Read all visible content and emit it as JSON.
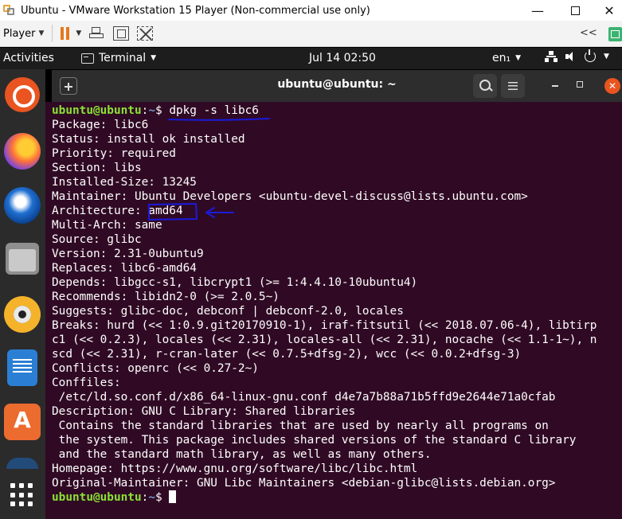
{
  "vmware": {
    "title": "Ubuntu - VMware Workstation 15 Player (Non-commercial use only)",
    "window_controls": {
      "minimize": "—",
      "close": "✕"
    },
    "toolbar": {
      "player_menu": "Player",
      "overflow": "<<"
    }
  },
  "gnome_bar": {
    "activities": "Activities",
    "app_menu": "Terminal",
    "clock": "Jul 14  02:50",
    "input_lang": "en₁"
  },
  "terminal": {
    "title": "ubuntu@ubuntu: ~",
    "close_symbol": "✕",
    "prompt": {
      "user": "ubuntu@ubuntu",
      "sep": ":",
      "path": "~",
      "symbol": "$ "
    },
    "command": "dpkg -s libc6",
    "output": [
      "Package: libc6",
      "Status: install ok installed",
      "Priority: required",
      "Section: libs",
      "Installed-Size: 13245",
      "Maintainer: Ubuntu Developers <ubuntu-devel-discuss@lists.ubuntu.com>",
      "Architecture: amd64",
      "Multi-Arch: same",
      "Source: glibc",
      "Version: 2.31-0ubuntu9",
      "Replaces: libc6-amd64",
      "Depends: libgcc-s1, libcrypt1 (>= 1:4.4.10-10ubuntu4)",
      "Recommends: libidn2-0 (>= 2.0.5~)",
      "Suggests: glibc-doc, debconf | debconf-2.0, locales",
      "Breaks: hurd (<< 1:0.9.git20170910-1), iraf-fitsutil (<< 2018.07.06-4), libtirp",
      "c1 (<< 0.2.3), locales (<< 2.31), locales-all (<< 2.31), nocache (<< 1.1-1~), n",
      "scd (<< 2.31), r-cran-later (<< 0.7.5+dfsg-2), wcc (<< 0.0.2+dfsg-3)",
      "Conflicts: openrc (<< 0.27-2~)",
      "Conffiles:",
      " /etc/ld.so.conf.d/x86_64-linux-gnu.conf d4e7a7b88a71b5ffd9e2644e71a0cfab",
      "Description: GNU C Library: Shared libraries",
      " Contains the standard libraries that are used by nearly all programs on",
      " the system. This package includes shared versions of the standard C library",
      " and the standard math library, as well as many others.",
      "Homepage: https://www.gnu.org/software/libc/libc.html",
      "Original-Maintainer: GNU Libc Maintainers <debian-glibc@lists.debian.org>"
    ]
  },
  "annotation_color": "#1a1adb",
  "colors": {
    "terminal_bg": "#300a24",
    "prompt_user": "#8ae234",
    "prompt_path": "#729fcf",
    "ubuntu_orange": "#e95420"
  }
}
